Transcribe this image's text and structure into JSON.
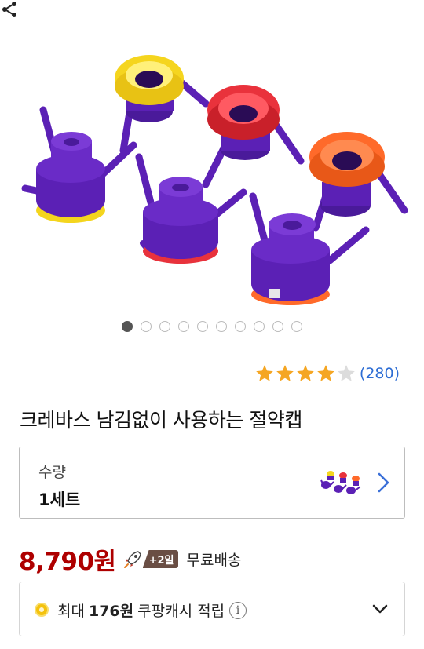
{
  "product": {
    "image_alt_icon": "bottle-cap-product-photo",
    "carousel": {
      "count": 10,
      "active_index": 0
    },
    "rating": {
      "stars": 4,
      "max": 5,
      "count_text": "(280)"
    },
    "title": "크레바스 남김없이 사용하는 절약캡"
  },
  "option": {
    "label": "수량",
    "value": "1세트"
  },
  "price": {
    "amount": "8,790원",
    "badge": "+2일",
    "shipping": "무료배송"
  },
  "cash": {
    "prefix": "최대",
    "amount": "176원",
    "suffix": "쿠팡캐시 적립",
    "info": "i"
  },
  "colors": {
    "price_red": "#ae0000",
    "link_blue": "#2d6dd4",
    "star_gold": "#f5a623",
    "purple": "#5a1fb0",
    "yellow": "#f4d51e",
    "red": "#e8323c",
    "orange": "#ff6a2a"
  }
}
